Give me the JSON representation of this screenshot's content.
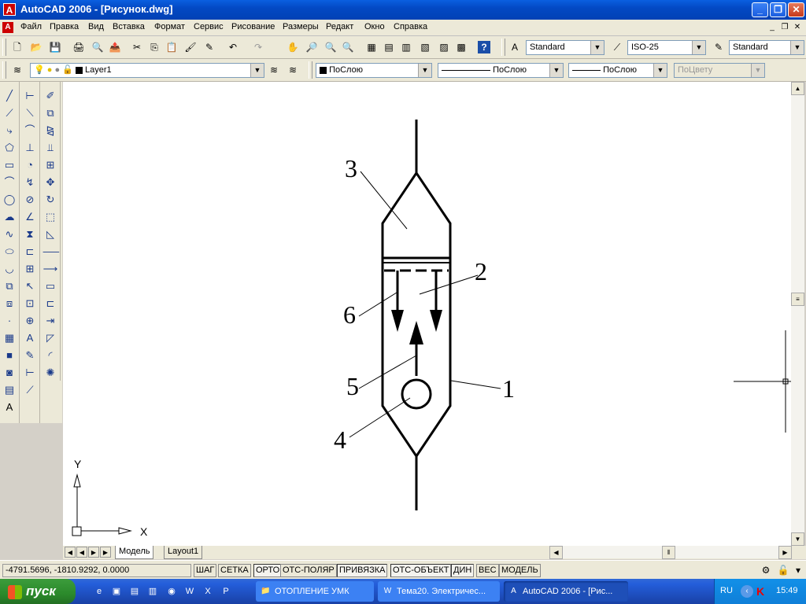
{
  "window": {
    "title": "AutoCAD 2006 - [Рисунок.dwg]",
    "app_icon": "A"
  },
  "menu": [
    "Файл",
    "Правка",
    "Вид",
    "Вставка",
    "Формат",
    "Сервис",
    "Рисование",
    "Размеры",
    "Редакт",
    "Окно",
    "Справка"
  ],
  "toolbar": {
    "text_style": "Standard",
    "dim_style": "ISO-25",
    "table_style": "Standard",
    "layer": "Layer1",
    "color": "ПоСлою",
    "linetype": "ПоСлою",
    "lineweight": "ПоСлою",
    "plotstyle": "ПоЦвету"
  },
  "drawing": {
    "labels": {
      "l1": "1",
      "l2": "2",
      "l3": "3",
      "l4": "4",
      "l5": "5",
      "l6": "6"
    },
    "ucs": {
      "x": "X",
      "y": "Y"
    }
  },
  "tabs": {
    "model": "Модель",
    "layout1": "Layout1"
  },
  "status": {
    "coords": "-4791.5696, -1810.9292, 0.0000",
    "buttons": [
      "ШАГ",
      "СЕТКА",
      "ОРТО",
      "ОТС-ПОЛЯР",
      "ПРИВЯЗКА",
      "ОТС-ОБЪЕКТ",
      "ДИН",
      "ВЕС",
      "МОДЕЛЬ"
    ]
  },
  "taskbar": {
    "start": "пуск",
    "tasks": [
      "ОТОПЛЕНИЕ УМК",
      "Тема20. Электричес...",
      "AutoCAD 2006 - [Рис..."
    ],
    "lang": "RU",
    "time": "15:49"
  }
}
